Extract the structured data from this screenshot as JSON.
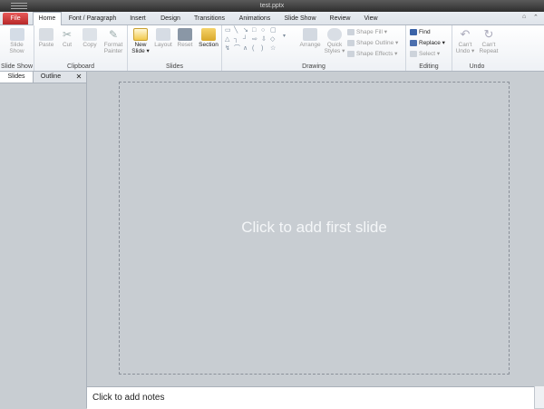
{
  "window": {
    "title": "test.pptx"
  },
  "tabs": [
    "File",
    "Home",
    "Font / Paragraph",
    "Insert",
    "Design",
    "Transitions",
    "Animations",
    "Slide Show",
    "Review",
    "View"
  ],
  "ribbon": {
    "slideshow": {
      "label": "Slide Show",
      "slide_show": "Slide Show"
    },
    "clipboard": {
      "label": "Clipboard",
      "paste": "Paste",
      "cut": "Cut",
      "copy": "Copy",
      "format_painter": "Format Painter"
    },
    "slides": {
      "label": "Slides",
      "new_slide": "New Slide ▾",
      "layout": "Layout",
      "reset": "Reset",
      "section": "Section"
    },
    "drawing": {
      "label": "Drawing",
      "arrange": "Arrange",
      "quick_styles": "Quick Styles ▾",
      "shape_fill": "Shape Fill ▾",
      "shape_outline": "Shape Outline ▾",
      "shape_effects": "Shape Effects ▾"
    },
    "editing": {
      "label": "Editing",
      "find": "Find",
      "replace": "Replace ▾",
      "select": "Select ▾"
    },
    "undo": {
      "label": "Undo",
      "cant_undo": "Can't Undo ▾",
      "cant_repeat": "Can't Repeat"
    }
  },
  "pane": {
    "slides_tab": "Slides",
    "outline_tab": "Outline",
    "close": "✕"
  },
  "editor": {
    "placeholder": "Click to add first slide"
  },
  "notes": {
    "placeholder": "Click to add notes"
  }
}
